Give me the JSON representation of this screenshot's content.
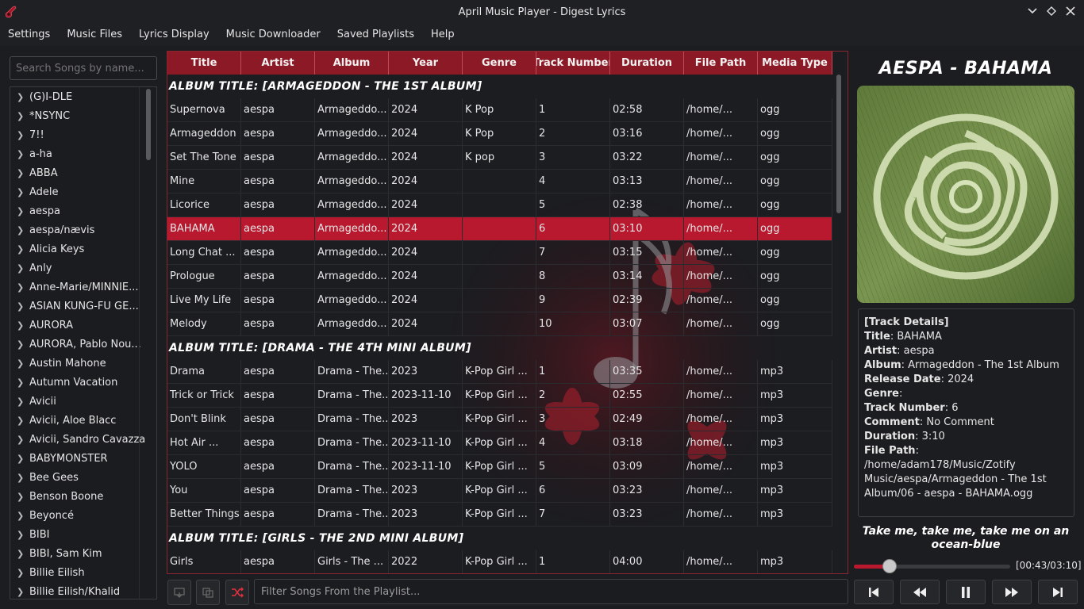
{
  "window": {
    "title": "April Music Player - Digest Lyrics"
  },
  "menu": [
    "Settings",
    "Music Files",
    "Lyrics Display",
    "Music Downloader",
    "Saved Playlists",
    "Help"
  ],
  "search": {
    "placeholder": "Search Songs by name..."
  },
  "artists": [
    "(G)I-DLE",
    "*NSYNC",
    "7!!",
    "a-ha",
    "ABBA",
    "Adele",
    "aespa",
    "aespa/nævis",
    "Alicia Keys",
    "Anly",
    "Anne-Marie/MINNIE...",
    "ASIAN KUNG-FU GE...",
    "AURORA",
    "AURORA, Pablo Nou...",
    "Austin Mahone",
    "Autumn Vacation",
    "Avicii",
    "Avicii, Aloe Blacc",
    "Avicii, Sandro Cavazza",
    "BABYMONSTER",
    "Bee Gees",
    "Benson Boone",
    "Beyoncé",
    "BIBI",
    "BIBI, Sam Kim",
    "Billie Eilish",
    "Billie Eilish/Khalid"
  ],
  "table": {
    "columns": [
      "Title",
      "Artist",
      "Album",
      "Year",
      "Genre",
      "Track Number",
      "Duration",
      "File Path",
      "Media Type"
    ],
    "groups": [
      {
        "album_title": "ALBUM TITLE: [ARMAGEDDON - THE 1ST ALBUM]",
        "rows": [
          [
            "Supernova",
            "aespa",
            "Armageddo...",
            "2024",
            "K Pop",
            "1",
            "02:58",
            "/home/...",
            "ogg"
          ],
          [
            "Armageddon",
            "aespa",
            "Armageddo...",
            "2024",
            "K Pop",
            "2",
            "03:16",
            "/home/...",
            "ogg"
          ],
          [
            "Set The Tone",
            "aespa",
            "Armageddo...",
            "2024",
            "K pop",
            "3",
            "03:22",
            "/home/...",
            "ogg"
          ],
          [
            "Mine",
            "aespa",
            "Armageddo...",
            "2024",
            "",
            "4",
            "03:13",
            "/home/...",
            "ogg"
          ],
          [
            "Licorice",
            "aespa",
            "Armageddo...",
            "2024",
            "",
            "5",
            "02:38",
            "/home/...",
            "ogg"
          ],
          [
            "BAHAMA",
            "aespa",
            "Armageddo...",
            "2024",
            "",
            "6",
            "03:10",
            "/home/...",
            "ogg"
          ],
          [
            "Long Chat ...",
            "aespa",
            "Armageddo...",
            "2024",
            "",
            "7",
            "03:15",
            "/home/...",
            "ogg"
          ],
          [
            "Prologue",
            "aespa",
            "Armageddo...",
            "2024",
            "",
            "8",
            "03:14",
            "/home/...",
            "ogg"
          ],
          [
            "Live My Life",
            "aespa",
            "Armageddo...",
            "2024",
            "",
            "9",
            "02:39",
            "/home/...",
            "ogg"
          ],
          [
            "Melody",
            "aespa",
            "Armageddo...",
            "2024",
            "",
            "10",
            "03:07",
            "/home/...",
            "ogg"
          ]
        ]
      },
      {
        "album_title": "ALBUM TITLE: [DRAMA - THE 4TH MINI ALBUM]",
        "rows": [
          [
            "Drama",
            "aespa",
            "Drama - The...",
            "2023",
            "K-Pop Girl ...",
            "1",
            "03:35",
            "/home/...",
            "mp3"
          ],
          [
            "Trick or Trick",
            "aespa",
            "Drama - The...",
            "2023-11-10",
            "K-Pop Girl ...",
            "2",
            "02:55",
            "/home/...",
            "mp3"
          ],
          [
            "Don't Blink",
            "aespa",
            "Drama - The...",
            "2023",
            "K-Pop Girl ...",
            "3",
            "02:49",
            "/home/...",
            "mp3"
          ],
          [
            "Hot Air ...",
            "aespa",
            "Drama - The...",
            "2023-11-10",
            "K-Pop Girl ...",
            "4",
            "03:18",
            "/home/...",
            "mp3"
          ],
          [
            "YOLO",
            "aespa",
            "Drama - The...",
            "2023-11-10",
            "K-Pop Girl ...",
            "5",
            "03:09",
            "/home/...",
            "mp3"
          ],
          [
            "You",
            "aespa",
            "Drama - The...",
            "2023",
            "K-Pop Girl ...",
            "6",
            "03:23",
            "/home/...",
            "mp3"
          ],
          [
            "Better Things",
            "aespa",
            "Drama - The...",
            "2023",
            "K-Pop Girl ...",
            "7",
            "03:23",
            "/home/...",
            "mp3"
          ]
        ]
      },
      {
        "album_title": "ALBUM TITLE: [GIRLS - THE 2ND MINI ALBUM]",
        "rows": [
          [
            "Girls",
            "aespa",
            "Girls - The ...",
            "2022",
            "K-Pop Girl ...",
            "1",
            "04:00",
            "/home/...",
            "mp3"
          ]
        ]
      }
    ],
    "selected_title": "BAHAMA"
  },
  "filter": {
    "placeholder": "Filter Songs From the Playlist..."
  },
  "now_playing": {
    "heading": "AESPA - BAHAMA",
    "details_header": "[Track Details]",
    "details": [
      {
        "label": "Title",
        "value": "BAHAMA"
      },
      {
        "label": "Artist",
        "value": "aespa"
      },
      {
        "label": "Album",
        "value": "Armageddon - The 1st Album"
      },
      {
        "label": "Release Date",
        "value": "2024"
      },
      {
        "label": "Genre",
        "value": ""
      },
      {
        "label": "Track Number",
        "value": "6"
      },
      {
        "label": "Comment",
        "value": "No Comment"
      },
      {
        "label": "Duration",
        "value": "3:10"
      },
      {
        "label": "File Path",
        "value": "/home/adam178/Music/Zotify Music/aespa/Armageddon - The 1st Album/06 - aespa - BAHAMA.ogg"
      }
    ],
    "lyric": "Take me, take me, take me on an ocean-blue",
    "time": "[00:43/03:10]",
    "progress_fraction": 0.226
  },
  "colors": {
    "accent": "#b8192e",
    "header": "#8c1a26",
    "background": "#1c1d20"
  }
}
